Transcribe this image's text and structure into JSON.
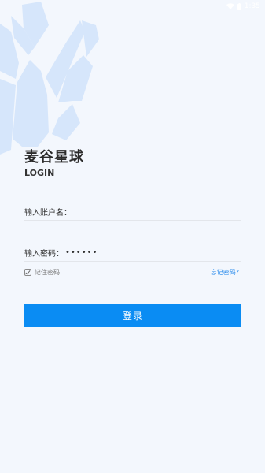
{
  "status_bar": {
    "time": "1:35",
    "wifi_icon": "wifi-icon",
    "battery_icon": "battery-icon"
  },
  "brand": {
    "title": "麦谷星球",
    "subtitle": "LOGIN",
    "logo_icon": "brand-logo-watermark",
    "logo_color": "#d6e6fb"
  },
  "form": {
    "username": {
      "label": "输入账户名：",
      "value": "",
      "placeholder": ""
    },
    "password": {
      "label": "输入密码：",
      "value": "••••••"
    },
    "remember": {
      "label": "记住密码",
      "checked": true
    },
    "forgot_label": "忘记密码?",
    "submit_label": "登录"
  },
  "colors": {
    "accent": "#0a8cf3",
    "link": "#1f86ec",
    "background": "#f3f7fd"
  }
}
